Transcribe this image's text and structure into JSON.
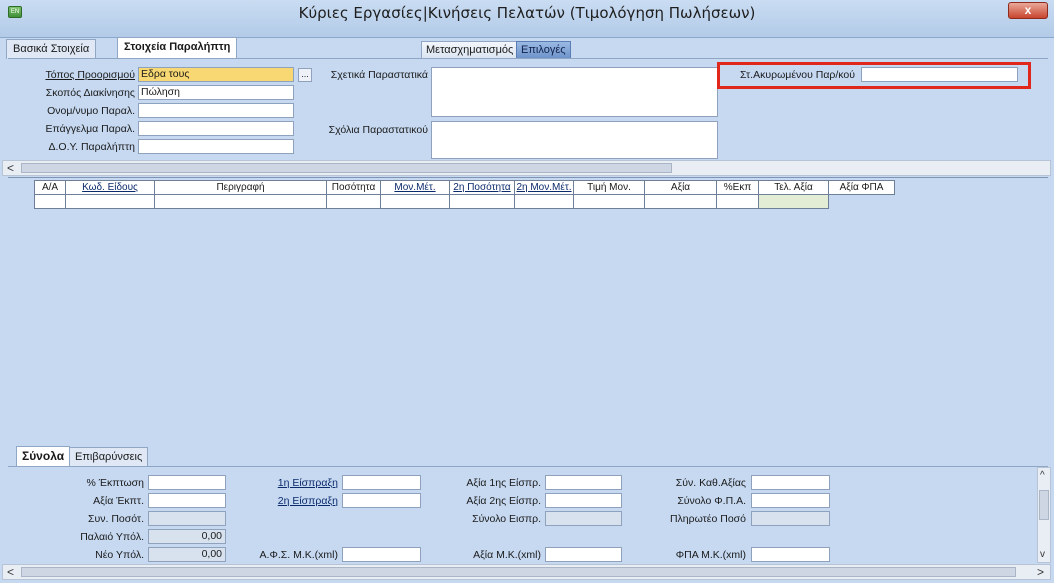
{
  "window": {
    "title": "Κύριες Εργασίες|Κινήσεις Πελατών (Τιμολόγηση Πωλήσεων)",
    "close_label": "x",
    "app_icon_label": "ΕΝ"
  },
  "tabs": [
    {
      "label": "Βασικά Στοιχεία",
      "active": false
    },
    {
      "label": "Στοιχεία Παραλήπτη",
      "active": true
    }
  ],
  "toolbar": {
    "transform_label": "Μετασχηματισμός",
    "options_label": "Επιλογές"
  },
  "receiver": {
    "destination_label": "Τόπος Προορισμού",
    "destination_value": "Εδρα τους",
    "purpose_label": "Σκοπός Διακίνησης",
    "purpose_value": "Πώληση",
    "name_label": "Ονομ/νυμο Παραλ.",
    "name_value": "",
    "job_label": "Επάγγελμα Παραλ.",
    "job_value": "",
    "doy_label": "Δ.Ο.Υ. Παραλήπτη",
    "doy_value": "",
    "dots_label": "...",
    "related_docs_label": "Σχετικά Παραστατικά",
    "comments_label": "Σχόλια Παραστατικού",
    "cancelled_label": "Στ.Ακυρωμένου Παρ/κού",
    "cancelled_value": ""
  },
  "scroll": {
    "left_arrow": "<",
    "right_arrow": ">",
    "up_arrow": "^",
    "down_arrow": "v"
  },
  "grid": {
    "columns": [
      "Α/Α",
      "Κωδ. Είδους",
      "Περιγραφή",
      "Ποσότητα",
      "Μον.Μέτ.",
      "2η Ποσότητα",
      "2η Μον.Μέτ.",
      "Τιμή Μον.",
      "Αξία",
      "%Εκπ",
      "Τελ. Αξία",
      "Αξία ΦΠΑ"
    ]
  },
  "bottom_tabs": [
    {
      "label": "Σύνολα",
      "active": true
    },
    {
      "label": "Επιβαρύνσεις",
      "active": false
    }
  ],
  "totals": {
    "discount_pct_label": "% Έκπτωση",
    "discount_value_label": "Αξία Έκπτ.",
    "total_qty_label": "Συν. Ποσότ.",
    "old_balance_label": "Παλαιό Υπόλ.",
    "old_balance_value": "0,00",
    "new_balance_label": "Νέο Υπόλ.",
    "new_balance_value": "0,00",
    "collection1_label": "1η Είσπραξη",
    "collection2_label": "2η Είσπραξη",
    "afs_label": "Α.Φ.Σ. Μ.Κ.(xml)",
    "value_collection1_label": "Αξία 1ης Είσπρ.",
    "value_collection2_label": "Αξία 2ης Είσπρ.",
    "total_collection_label": "Σύνολο Εισπρ.",
    "value_mk_label": "Αξία Μ.Κ.(xml)",
    "net_total_label": "Σύν. Καθ.Αξίας",
    "vat_total_label": "Σύνολο Φ.Π.Α.",
    "payable_label": "Πληρωτέο Ποσό",
    "vat_mk_label": "ΦΠΑ Μ.Κ.(xml)"
  },
  "colors": {
    "highlight_box": "#e1261c",
    "yellow_field": "#f8d873",
    "background": "#c6d9f1"
  }
}
